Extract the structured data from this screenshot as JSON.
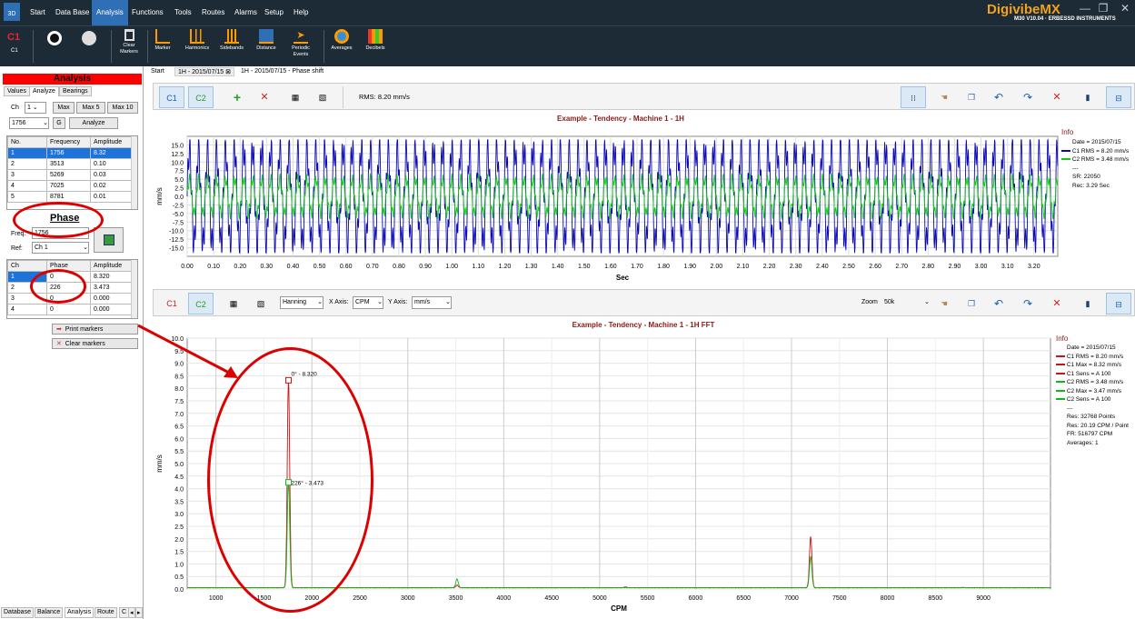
{
  "app": {
    "icon_label": "3D",
    "brand": "DigivibeMX",
    "brand_sub": "M30 V10.04 · ERBESSD INSTRUMENTS"
  },
  "menu": [
    "Start",
    "Data Base",
    "Analysis",
    "Functions",
    "Tools",
    "Routes",
    "Alarms",
    "Setup",
    "Help"
  ],
  "ribbon": {
    "channel_top": "C1",
    "channel_bottom": "C1",
    "items": [
      "Clear Markers",
      "Marker",
      "Harmonics",
      "Sidebands",
      "Distance",
      "Periodic Events",
      "Averages",
      "Decibels"
    ]
  },
  "left": {
    "header": "Analysis",
    "tabs": [
      "Values",
      "Analyze",
      "Bearings"
    ],
    "ch_label": "Ch",
    "ch_value": "1",
    "max_buttons": [
      "Max",
      "Max 5",
      "Max 10"
    ],
    "freq_value": "1756",
    "g_button": "G",
    "analyze_button": "Analyze",
    "peaks_headers": [
      "No.",
      "Frequency",
      "Amplitude"
    ],
    "peaks": [
      [
        "1",
        "1756",
        "8.32"
      ],
      [
        "2",
        "3513",
        "0.10"
      ],
      [
        "3",
        "5269",
        "0.03"
      ],
      [
        "4",
        "7025",
        "0.02"
      ],
      [
        "5",
        "8781",
        "0.01"
      ]
    ],
    "phase_title": "Phase",
    "freq_label": "Freq.",
    "freq_select": "1756",
    "ref_label": "Ref:",
    "ref_select": "Ch 1",
    "phase_headers": [
      "Ch",
      "Phase",
      "Amplitude"
    ],
    "phase_rows": [
      [
        "1",
        "0",
        "8.320"
      ],
      [
        "2",
        "226",
        "3.473"
      ],
      [
        "3",
        "0",
        "0.000"
      ],
      [
        "4",
        "0",
        "0.000"
      ]
    ],
    "print_markers": "Print markers",
    "clear_markers": "Clear markers",
    "bottom_tabs": [
      "Database",
      "Balance",
      "Analysis",
      "Route",
      "C"
    ]
  },
  "doc_tabs": [
    "Start",
    "1H - 2015/07/15",
    "1H - 2015/07/15 - Phase shift"
  ],
  "top_panel": {
    "c1": "C1",
    "c2": "C2",
    "rms": "RMS: 8.20 mm/s",
    "title": "Example - Tendency - Machine 1 - 1H",
    "ylabel": "mm/s",
    "xlabel": "Sec",
    "info_title": "Info",
    "info": [
      "Date = 2015/07/15",
      "C1 RMS = 8.20 mm/s",
      "C2 RMS = 3.48 mm/s",
      "---",
      "SR: 22050",
      "Rec: 3.29 Sec"
    ]
  },
  "bottom_panel": {
    "c1": "C1",
    "c2": "C2",
    "window": "Hanning",
    "xaxis_label": "X Axis:",
    "xaxis": "CPM",
    "yaxis_label": "Y Axis:",
    "yaxis": "mm/s",
    "zoom_label": "Zoom",
    "zoom": "50k",
    "title": "Example - Tendency - Machine 1 - 1H FFT",
    "ylabel": "mm/s",
    "xlabel": "CPM",
    "marker1": "0° - 8.320",
    "marker2": "226° - 3.473",
    "info_title": "Info",
    "info": [
      "Date = 2015/07/15",
      "C1 RMS = 8.20 mm/s",
      "C1 Max = 8.32 mm/s",
      "C1 Sens = A 100",
      "C2 RMS = 3.48 mm/s",
      "C2 Max = 3.47 mm/s",
      "C2 Sens = A 100",
      "---",
      "Res: 32768 Points",
      "Res: 20.19 CPM / Point",
      "FR: 516797 CPM",
      "Averages: 1"
    ]
  },
  "colors": {
    "c1": "#0a0ab4",
    "c2": "#18c818",
    "fft1": "#c81414",
    "fft2": "#18b418",
    "accent": "#2f6fb5",
    "title": "#8b1a1a"
  },
  "chart_data": [
    {
      "type": "line",
      "title": "Example - Tendency - Machine 1 - 1H",
      "xlabel": "Sec",
      "ylabel": "mm/s",
      "xlim": [
        0,
        3.29
      ],
      "ylim": [
        -17.5,
        17.5
      ],
      "x_ticks": [
        0.0,
        0.1,
        0.2,
        0.3,
        0.4,
        0.5,
        0.6,
        0.7,
        0.8,
        0.9,
        1.0,
        1.1,
        1.2,
        1.3,
        1.4,
        1.5,
        1.6,
        1.7,
        1.8,
        1.9,
        2.0,
        2.1,
        2.2,
        2.3,
        2.4,
        2.5,
        2.6,
        2.7,
        2.8,
        2.9,
        3.0,
        3.1,
        3.2
      ],
      "y_ticks": [
        15.0,
        12.5,
        10.0,
        7.5,
        5.0,
        2.5,
        0.0,
        -2.5,
        -5.0,
        -7.5,
        -10.0,
        -12.5,
        -15.0
      ],
      "series": [
        {
          "name": "C1",
          "amplitude": 14,
          "frequency_cpm": 1756
        },
        {
          "name": "C2",
          "amplitude": 5,
          "frequency_cpm": 1756
        }
      ]
    },
    {
      "type": "line",
      "title": "Example - Tendency - Machine 1 - 1H FFT",
      "xlabel": "CPM",
      "ylabel": "mm/s",
      "xlim": [
        700,
        9700
      ],
      "ylim": [
        0,
        10
      ],
      "x_ticks": [
        1000,
        1500,
        2000,
        2500,
        3000,
        3500,
        4000,
        4500,
        5000,
        5500,
        6000,
        6500,
        7000,
        7500,
        8000,
        8500,
        9000
      ],
      "y_ticks": [
        0.0,
        0.5,
        1.0,
        1.5,
        2.0,
        2.5,
        3.0,
        3.5,
        4.0,
        4.5,
        5.0,
        5.5,
        6.0,
        6.5,
        7.0,
        7.5,
        8.0,
        8.5,
        9.0,
        9.5,
        10.0
      ],
      "series": [
        {
          "name": "C1",
          "peaks": [
            {
              "x": 1756,
              "y": 8.32
            },
            {
              "x": 3513,
              "y": 0.1
            },
            {
              "x": 5269,
              "y": 0.03
            },
            {
              "x": 7200,
              "y": 2.05
            },
            {
              "x": 8781,
              "y": 0.01
            }
          ]
        },
        {
          "name": "C2",
          "peaks": [
            {
              "x": 1756,
              "y": 4.25
            },
            {
              "x": 3513,
              "y": 0.35
            },
            {
              "x": 7200,
              "y": 1.25
            }
          ]
        }
      ]
    }
  ]
}
